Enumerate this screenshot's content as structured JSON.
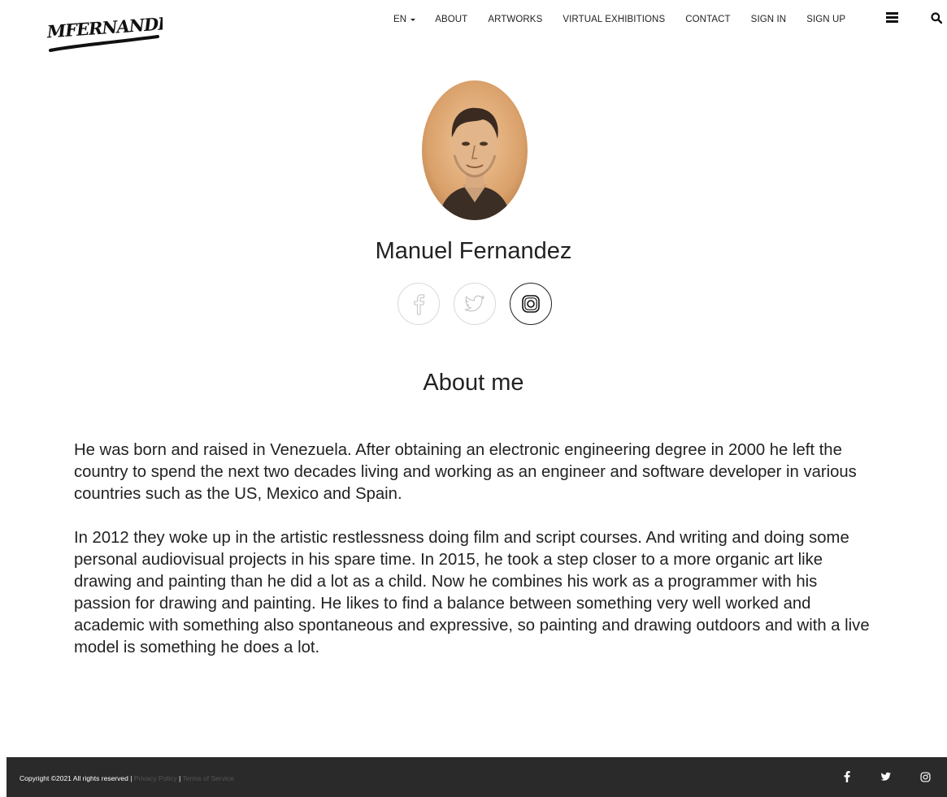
{
  "header": {
    "logo_text": "MFERNANDEZ",
    "nav": {
      "language": "EN",
      "items": [
        "ABOUT",
        "ARTWORKS",
        "VIRTUAL EXHIBITIONS",
        "CONTACT",
        "SIGN IN",
        "SIGN UP"
      ]
    },
    "icons": [
      "menu-icon",
      "search-icon"
    ]
  },
  "profile": {
    "name": "Manuel Fernandez",
    "social": [
      "facebook-icon",
      "twitter-icon",
      "instagram-icon"
    ],
    "active_social": "instagram"
  },
  "about": {
    "title": "About me",
    "paragraphs": [
      "He was born and raised in Venezuela. After obtaining an electronic engineering degree in 2000 he left the country to spend the next two decades living and working as an engineer and software developer in various countries such as the US, Mexico and Spain.",
      "In 2012 they woke up in the artistic restlessness doing film and script courses. And writing and doing some personal audiovisual projects in his spare time. In 2015, he took a step closer to a more organic art like drawing and painting than he did a lot as a child. Now he combines his work as a programmer with his passion for drawing and painting. He likes to find a balance between something very well worked and academic with something also spontaneous and expressive, so painting and drawing outdoors and with a live model is something he does a lot."
    ]
  },
  "footer": {
    "copyright": "Copyright ©2021 All rights reserved",
    "separator": "|",
    "privacy_link": "Privacy Policy",
    "terms_link": "Terms of Service",
    "social": [
      "facebook-icon",
      "twitter-icon",
      "instagram-icon"
    ]
  },
  "colors": {
    "footer_bg": "#2a2a2a",
    "text": "#222222",
    "muted_link": "#555555"
  }
}
